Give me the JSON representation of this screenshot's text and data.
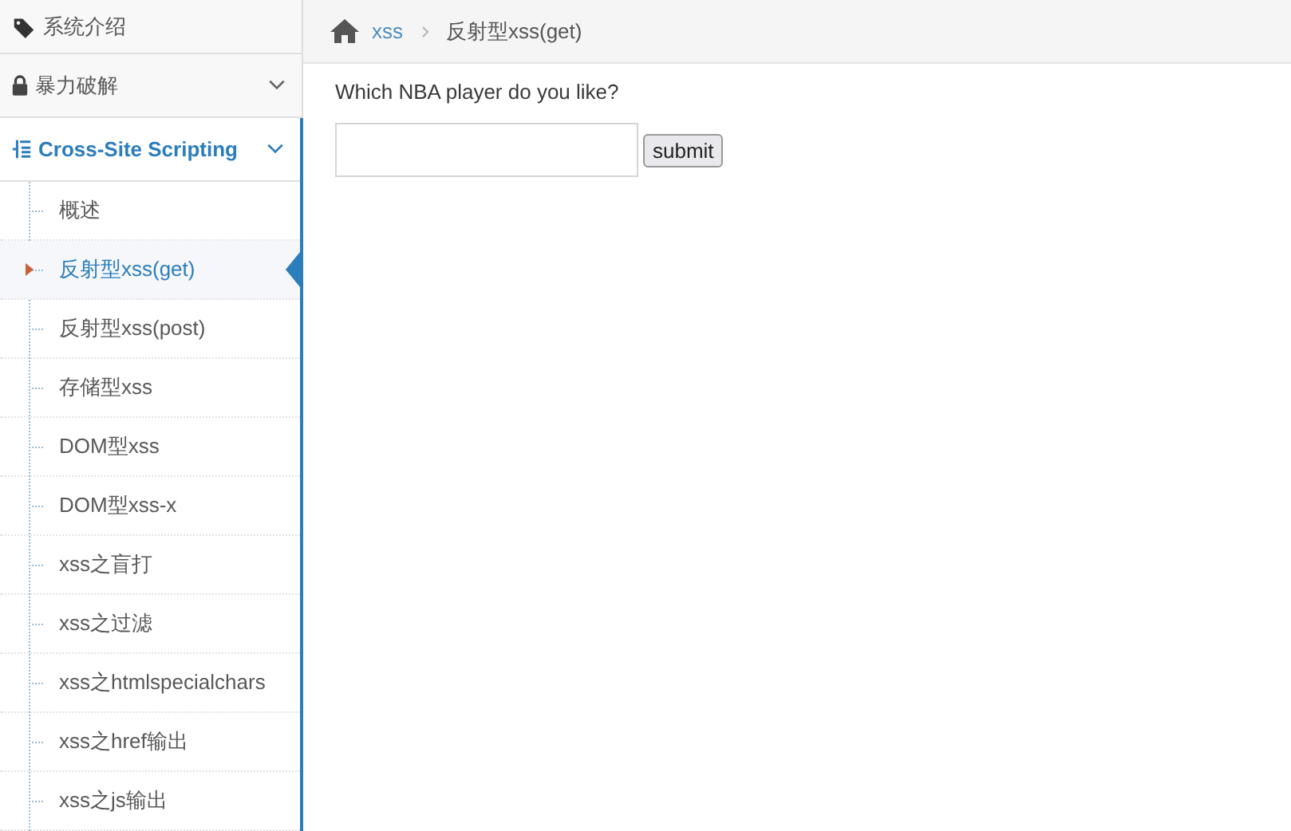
{
  "sidebar": {
    "items": [
      {
        "label": "系统介绍",
        "kind": "link"
      },
      {
        "label": "暴力破解",
        "kind": "group",
        "expanded": false
      },
      {
        "label": "Cross-Site Scripting",
        "kind": "group",
        "expanded": true,
        "children": [
          {
            "label": "概述",
            "selected": false
          },
          {
            "label": "反射型xss(get)",
            "selected": true
          },
          {
            "label": "反射型xss(post)",
            "selected": false
          },
          {
            "label": "存储型xss",
            "selected": false
          },
          {
            "label": "DOM型xss",
            "selected": false
          },
          {
            "label": "DOM型xss-x",
            "selected": false
          },
          {
            "label": "xss之盲打",
            "selected": false
          },
          {
            "label": "xss之过滤",
            "selected": false
          },
          {
            "label": "xss之htmlspecialchars",
            "selected": false
          },
          {
            "label": "xss之href输出",
            "selected": false
          },
          {
            "label": "xss之js输出",
            "selected": false
          }
        ]
      }
    ]
  },
  "breadcrumb": [
    {
      "label": "xss",
      "kind": "link"
    },
    {
      "label": "反射型xss(get)",
      "kind": "current"
    }
  ],
  "form": {
    "question": "Which NBA player do you like?",
    "button": "submit"
  }
}
